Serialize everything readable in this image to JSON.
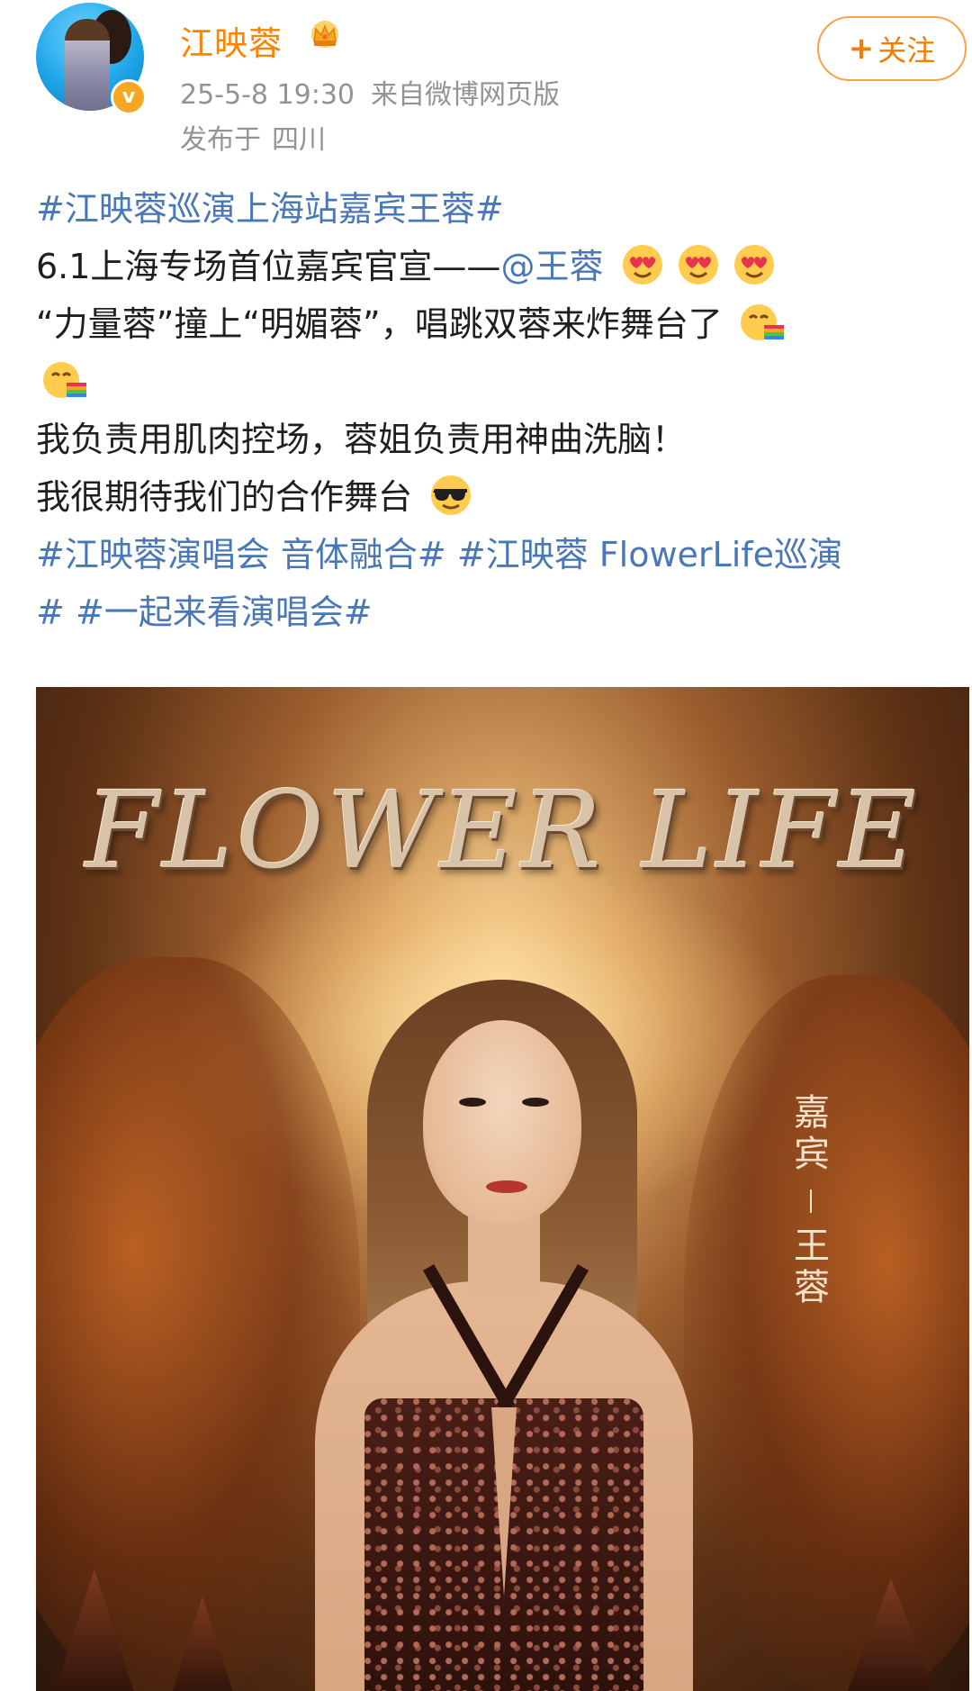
{
  "header": {
    "user_name": "江映蓉",
    "timestamp": "25-5-8 19:30",
    "source": "来自微博网页版",
    "location_prefix": "发布于",
    "location": "四川",
    "follow_label": "关注",
    "follow_plus": "+",
    "verified_mark": "v"
  },
  "post": {
    "hashtag_top": "#江映蓉巡演上海站嘉宾王蓉#",
    "line1_text": "6.1上海专场首位嘉宾官宣——",
    "line1_mention": "@王蓉",
    "line2_text": "“力量蓉”撞上“明媚蓉”，唱跳双蓉来炸舞台了",
    "line4_text": "我负责用肌肉控场，蓉姐负责用神曲洗脑！",
    "line5_text": "我很期待我们的合作舞台",
    "tag_a": "#江映蓉演唱会 音体融合#",
    "tag_b_part1": "#江映蓉 FlowerLife巡演",
    "tag_b_part2": "#",
    "tag_c": "#一起来看演唱会#",
    "emojis": [
      "heart-eyes-emoji",
      "rainbow-vomit-emoji",
      "sunglasses-emoji"
    ]
  },
  "poster": {
    "title": "FLOWER LIFE",
    "guest_label": "嘉宾",
    "guest_name": "王蓉"
  },
  "colors": {
    "username": "#ff8200",
    "link": "#4a78b5",
    "meta": "#939393",
    "follow_border": "#f8a24a"
  }
}
